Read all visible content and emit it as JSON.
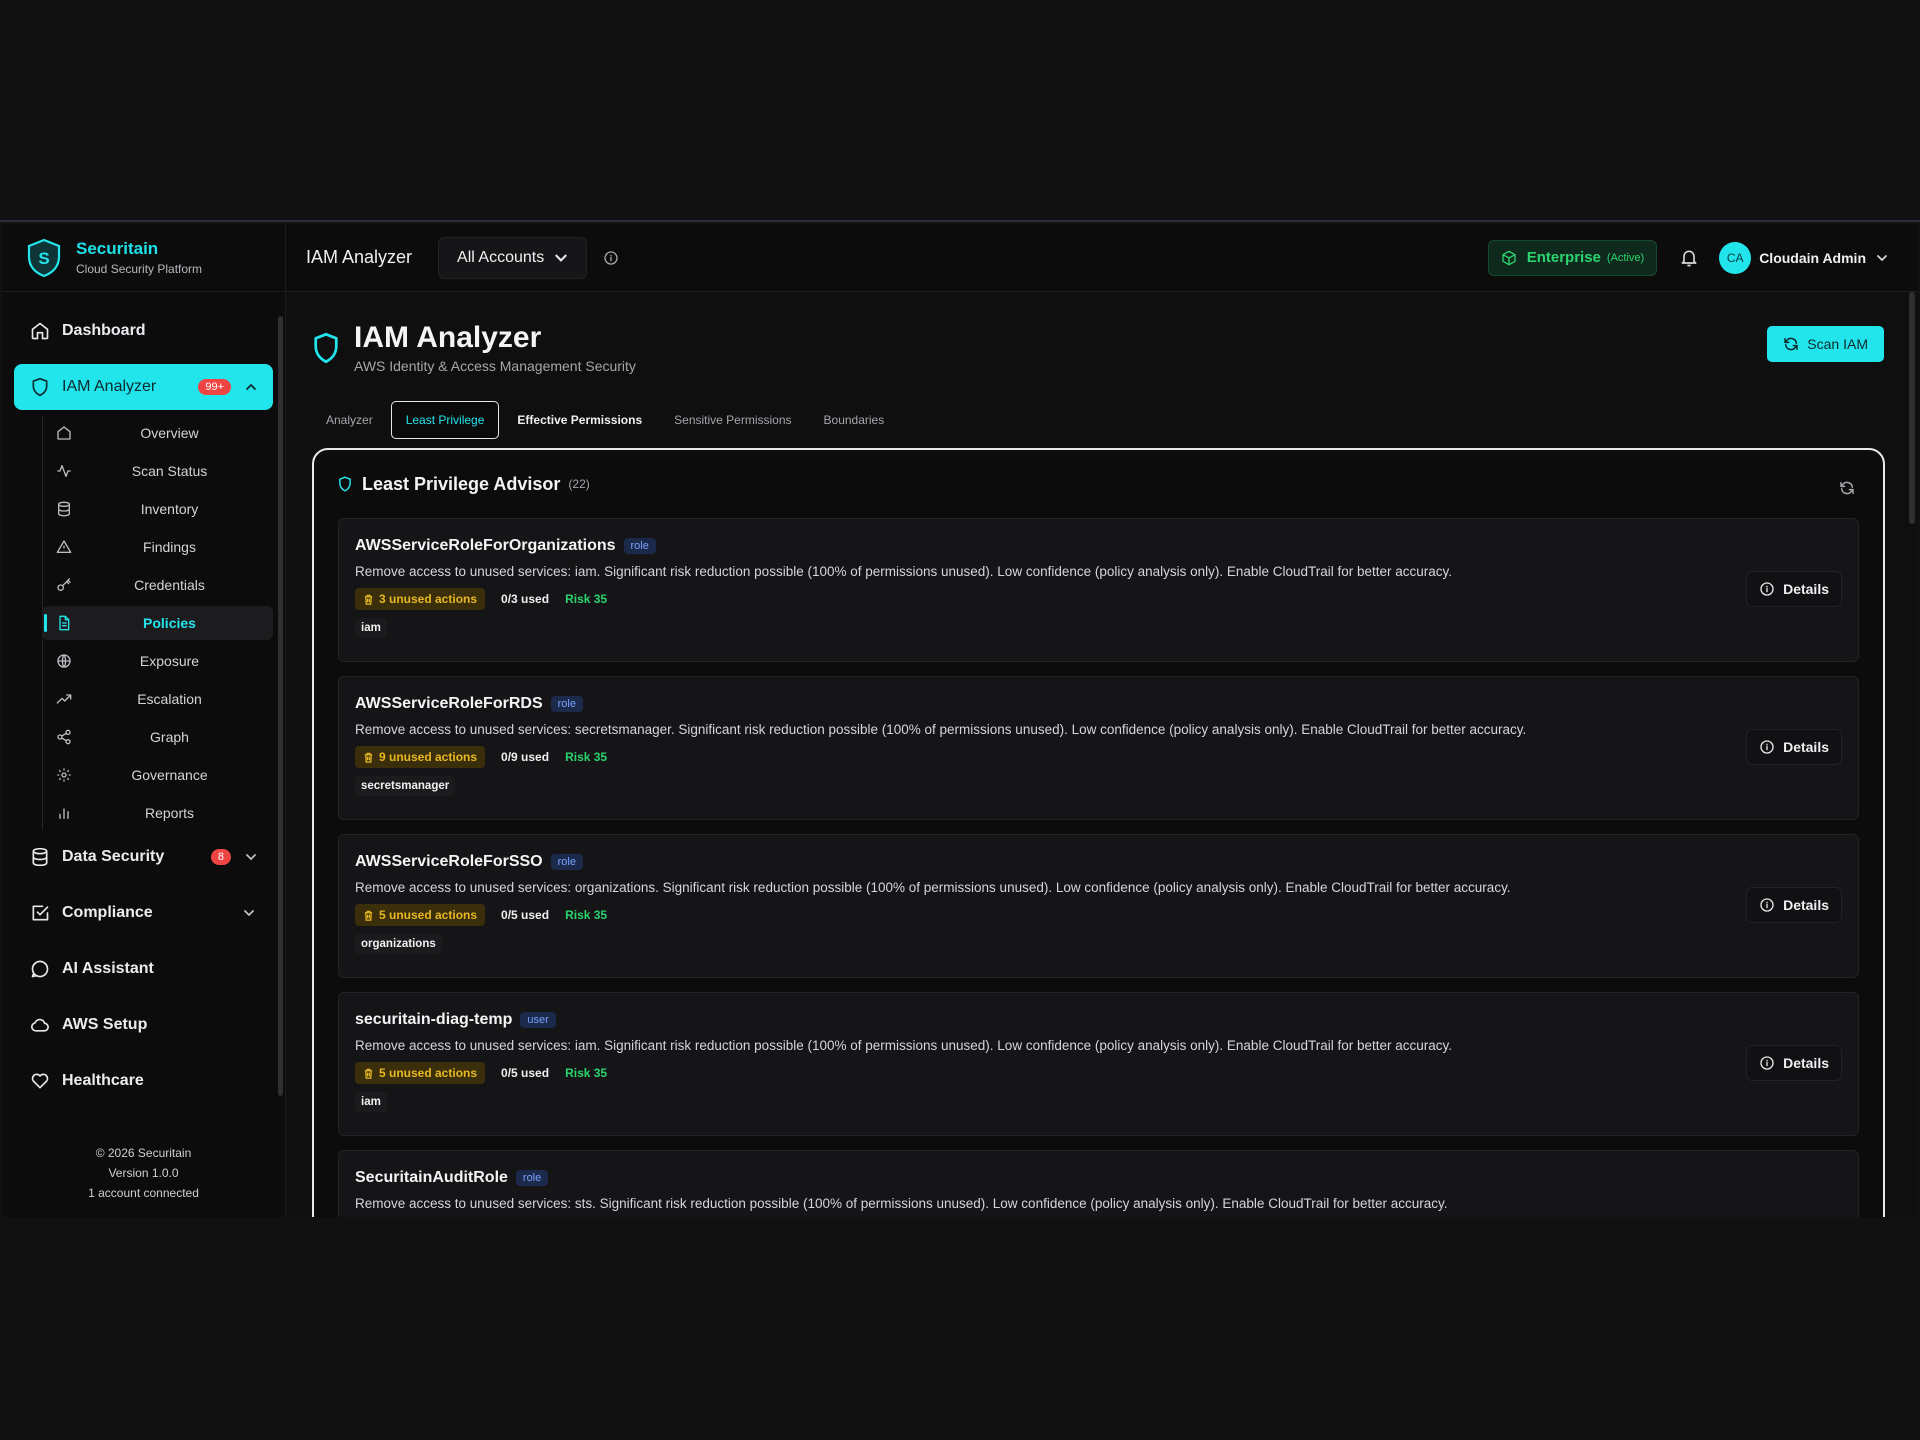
{
  "brand": {
    "name": "Securitain",
    "subtitle": "Cloud Security Platform",
    "logo_letter": "S"
  },
  "sidebar": {
    "items": [
      {
        "label": "Dashboard",
        "icon": "home-icon"
      },
      {
        "label": "IAM Analyzer",
        "icon": "shield-icon",
        "badge": "99+"
      },
      {
        "label": "Data Security",
        "icon": "database-icon",
        "badge": "8"
      },
      {
        "label": "Compliance",
        "icon": "check-square-icon"
      },
      {
        "label": "AI Assistant",
        "icon": "chat-icon"
      },
      {
        "label": "AWS Setup",
        "icon": "cloud-icon"
      },
      {
        "label": "Healthcare",
        "icon": "heart-icon"
      }
    ],
    "sub_items": [
      {
        "label": "Overview",
        "icon": "home-icon"
      },
      {
        "label": "Scan Status",
        "icon": "activity-icon"
      },
      {
        "label": "Inventory",
        "icon": "database-icon"
      },
      {
        "label": "Findings",
        "icon": "warning-icon"
      },
      {
        "label": "Credentials",
        "icon": "key-icon"
      },
      {
        "label": "Policies",
        "icon": "file-icon"
      },
      {
        "label": "Exposure",
        "icon": "globe-icon"
      },
      {
        "label": "Escalation",
        "icon": "trending-up-icon"
      },
      {
        "label": "Graph",
        "icon": "share-icon"
      },
      {
        "label": "Governance",
        "icon": "gear-icon"
      },
      {
        "label": "Reports",
        "icon": "bar-chart-icon"
      }
    ],
    "footer": {
      "copyright": "© 2026 Securitain",
      "version": "Version 1.0.0",
      "accounts": "1 account connected"
    }
  },
  "topbar": {
    "title": "IAM Analyzer",
    "account_selector": "All Accounts",
    "plan": "Enterprise",
    "plan_status": "(Active)",
    "avatar_initials": "CA",
    "user_name": "Cloudain Admin"
  },
  "page": {
    "title": "IAM Analyzer",
    "subtitle": "AWS Identity & Access Management Security",
    "scan_button": "Scan IAM"
  },
  "tabs": [
    "Analyzer",
    "Least Privilege",
    "Effective Permissions",
    "Sensitive Permissions",
    "Boundaries"
  ],
  "panel": {
    "title": "Least Privilege Advisor",
    "count": "(22)",
    "details_label": "Details",
    "cards": [
      {
        "name": "AWSServiceRoleForOrganizations",
        "type": "role",
        "description": "Remove access to unused services: iam. Significant risk reduction possible (100% of permissions unused). Low confidence (policy analysis only). Enable CloudTrail for better accuracy.",
        "unused": "3 unused actions",
        "used": "0/3 used",
        "risk": "Risk 35",
        "service": "iam"
      },
      {
        "name": "AWSServiceRoleForRDS",
        "type": "role",
        "description": "Remove access to unused services: secretsmanager. Significant risk reduction possible (100% of permissions unused). Low confidence (policy analysis only). Enable CloudTrail for better accuracy.",
        "unused": "9 unused actions",
        "used": "0/9 used",
        "risk": "Risk 35",
        "service": "secretsmanager"
      },
      {
        "name": "AWSServiceRoleForSSO",
        "type": "role",
        "description": "Remove access to unused services: organizations. Significant risk reduction possible (100% of permissions unused). Low confidence (policy analysis only). Enable CloudTrail for better accuracy.",
        "unused": "5 unused actions",
        "used": "0/5 used",
        "risk": "Risk 35",
        "service": "organizations"
      },
      {
        "name": "securitain-diag-temp",
        "type": "user",
        "description": "Remove access to unused services: iam. Significant risk reduction possible (100% of permissions unused). Low confidence (policy analysis only). Enable CloudTrail for better accuracy.",
        "unused": "5 unused actions",
        "used": "0/5 used",
        "risk": "Risk 35",
        "service": "iam"
      },
      {
        "name": "SecuritainAuditRole",
        "type": "role",
        "description": "Remove access to unused services: sts. Significant risk reduction possible (100% of permissions unused). Low confidence (policy analysis only). Enable CloudTrail for better accuracy.",
        "unused": "",
        "used": "",
        "risk": "",
        "service": ""
      }
    ]
  },
  "colors": {
    "accent": "#22e5ec",
    "warning": "#e7b824",
    "success": "#2bd46f",
    "danger": "#ef4444"
  }
}
